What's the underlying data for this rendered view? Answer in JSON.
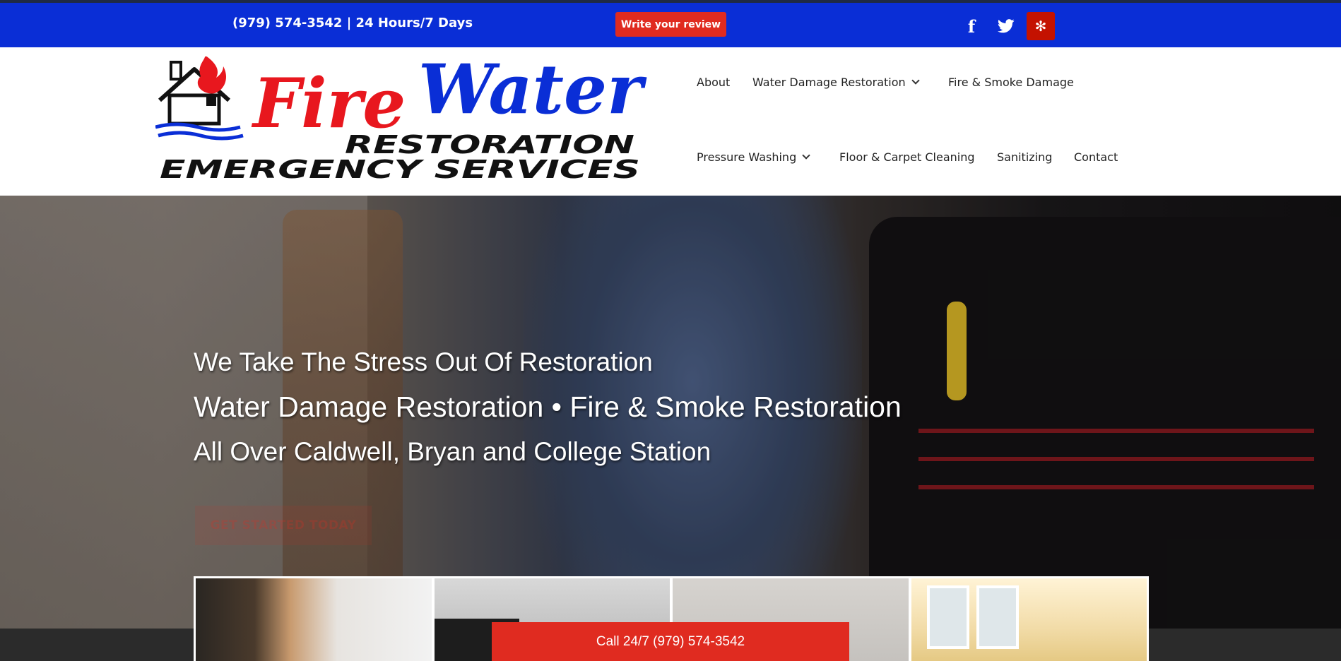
{
  "topbar": {
    "phone_hours": "(979) 574-3542 | 24 Hours/7 Days",
    "review_button": "Write your review",
    "social": [
      {
        "name": "facebook-icon",
        "glyph": "f"
      },
      {
        "name": "twitter-icon"
      },
      {
        "name": "yelp-icon",
        "glyph": "✻"
      }
    ],
    "bar_color": "#0a2ed6",
    "accent": "#e02b20"
  },
  "logo": {
    "fire": "Fire",
    "water": "Water",
    "line1": "RESTORATION",
    "line2": "EMERGENCY SERVICES",
    "fire_color": "#e8171e",
    "water_color": "#0a2ed6"
  },
  "nav": {
    "about": "About",
    "water_damage": "Water Damage Restoration",
    "fire_smoke": "Fire & Smoke Damage",
    "pressure_washing": "Pressure Washing",
    "floor_carpet": "Floor & Carpet Cleaning",
    "sanitizing": "Sanitizing",
    "contact": "Contact"
  },
  "hero": {
    "line1": "We Take The Stress Out Of Restoration",
    "line2": "Water Damage Restoration • Fire & Smoke Restoration",
    "line3": "All Over Caldwell, Bryan and College Station",
    "cta": "GET STARTED TODAY"
  },
  "callbar": {
    "label": "Call 24/7 (979) 574-3542"
  }
}
